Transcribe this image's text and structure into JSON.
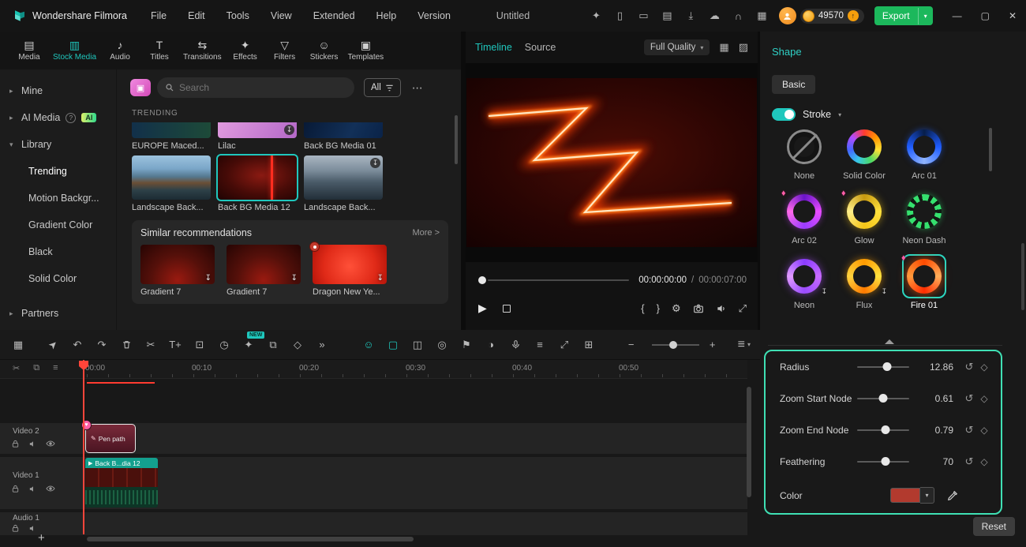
{
  "titlebar": {
    "app_name": "Wondershare Filmora",
    "menus": [
      "File",
      "Edit",
      "Tools",
      "View",
      "Extended",
      "Help",
      "Version"
    ],
    "project_title": "Untitled",
    "coins": "49570",
    "export_label": "Export"
  },
  "media_tabs": [
    {
      "label": "Media"
    },
    {
      "label": "Stock Media"
    },
    {
      "label": "Audio"
    },
    {
      "label": "Titles"
    },
    {
      "label": "Transitions"
    },
    {
      "label": "Effects"
    },
    {
      "label": "Filters"
    },
    {
      "label": "Stickers"
    },
    {
      "label": "Templates"
    }
  ],
  "sidebar": {
    "items": [
      {
        "label": "Mine"
      },
      {
        "label": "AI Media"
      },
      {
        "label": "Library"
      }
    ],
    "ai_badge": "AI",
    "library_items": [
      {
        "label": "Trending"
      },
      {
        "label": "Motion Backgr..."
      },
      {
        "label": "Gradient Color"
      },
      {
        "label": "Black"
      },
      {
        "label": "Solid Color"
      }
    ],
    "partners": "Partners"
  },
  "media_panel": {
    "search_placeholder": "Search",
    "filter_all": "All",
    "section_trending": "TRENDING",
    "row1": [
      {
        "label": "EUROPE Maced..."
      },
      {
        "label": "Lilac"
      },
      {
        "label": "Back BG Media 01"
      }
    ],
    "row2": [
      {
        "label": "Landscape Back..."
      },
      {
        "label": "Back BG Media 12"
      },
      {
        "label": "Landscape Back..."
      }
    ],
    "similar": {
      "title": "Similar recommendations",
      "more": "More >",
      "items": [
        {
          "label": "Gradient 7"
        },
        {
          "label": "Gradient 7"
        },
        {
          "label": "Dragon New Ye..."
        }
      ]
    }
  },
  "preview": {
    "tab_timeline": "Timeline",
    "tab_source": "Source",
    "quality": "Full Quality",
    "time_current": "00:00:00:00",
    "time_separator": "/",
    "time_total": "00:00:07:00"
  },
  "shape_panel": {
    "title": "Shape",
    "tab_basic": "Basic",
    "stroke_label": "Stroke",
    "presets": [
      {
        "label": "None"
      },
      {
        "label": "Solid Color"
      },
      {
        "label": "Arc 01"
      },
      {
        "label": "Arc 02"
      },
      {
        "label": "Glow"
      },
      {
        "label": "Neon Dash"
      },
      {
        "label": "Neon"
      },
      {
        "label": "Flux"
      },
      {
        "label": "Fire 01"
      }
    ],
    "properties": [
      {
        "label": "Radius",
        "value": "12.86",
        "pos": 58
      },
      {
        "label": "Zoom Start Node",
        "value": "0.61",
        "pos": 50
      },
      {
        "label": "Zoom End Node",
        "value": "0.79",
        "pos": 54
      },
      {
        "label": "Feathering",
        "value": "70",
        "pos": 54
      }
    ],
    "color_label": "Color",
    "color_value": "#b23a2e",
    "reset_label": "Reset",
    "accent": "#3fe0b4"
  },
  "timeline": {
    "new_badge": "NEW",
    "ruler": [
      "00:00",
      "00:10",
      "00:20",
      "00:30",
      "00:40",
      "00:50"
    ],
    "tracks": [
      {
        "name": "Video 2",
        "clip": "Pen path"
      },
      {
        "name": "Video 1",
        "clip": "Back B...dia 12"
      },
      {
        "name": "Audio 1"
      }
    ]
  }
}
